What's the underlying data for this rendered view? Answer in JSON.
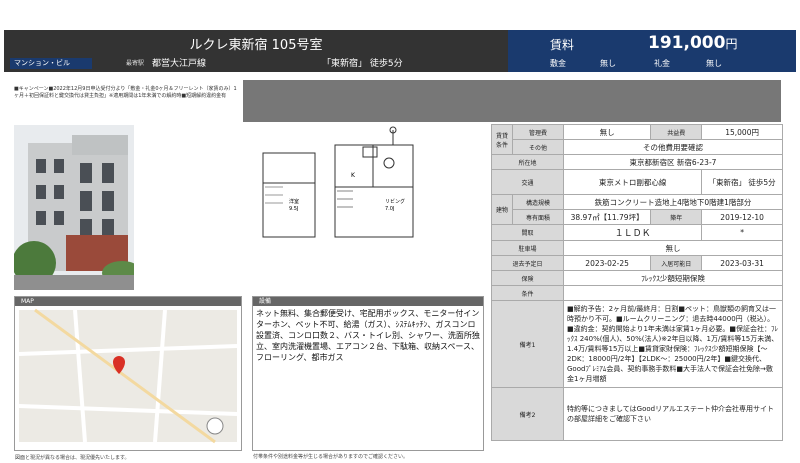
{
  "header": {
    "title": "ルクレ東新宿 105号室",
    "property_type": "マンション・ビル",
    "station_label": "最寄駅",
    "line": "都営大江戸線",
    "station_walk": "「東新宿」 徒歩5分",
    "rent_label": "賃料",
    "rent_value": "191,000",
    "rent_unit": "円",
    "deposit_label": "敷金",
    "deposit_value": "無し",
    "key_money_label": "礼金",
    "key_money_value": "無し"
  },
  "notice": "■キャンペーン■2022年12月9日申込受付分より「敷金・礼金0ヶ月＆フリーレント（家賃のみ）1ヶ月＋初回保証料と鍵交換代は貸主負担」※適用期間は1年未満での解約時■短期解約違約金有",
  "map": {
    "label": "MAP",
    "footnote": "図面と現況が異なる場合は、現況優先いたします。"
  },
  "memo": {
    "label": "設備",
    "text": "ネット無料、集合郵便受け、宅配用ボックス、モニター付インターホン、ペット不可、給湯（ガス）、ｼｽﾃﾑｷｯﾁﾝ、ガスコンロ設置済、コンロ口数２、バス・トイレ別、シャワー、洗面所独立、室内洗濯機置場、エアコン２台、下駄箱、収納スペース、フローリング、都市ガス",
    "footnote": "付帯条件や別途料金等が生じる場合がありますのでご確認ください。"
  },
  "floor_plan": {
    "room1": "洋室",
    "room1_size": "9.5J",
    "room2": "リビング",
    "room2_size": "7.0J",
    "k": "K"
  },
  "table": {
    "pay_group": "賃貸条件",
    "mgmt_label": "管理費",
    "mgmt_value": "無し",
    "common_label": "共益費",
    "common_value": "15,000円",
    "other_label": "その他",
    "other_value": "その他費用要確認",
    "address_label": "所在地",
    "address_value": "東京都新宿区 新宿6-23-7",
    "transit_label": "交通",
    "transit_line": "東京メトロ副都心線",
    "transit_walk": "「東新宿」 徒歩5分",
    "building_group": "建物",
    "structure_label": "構造規模",
    "structure_value": "鉄筋コンクリート造地上4階地下0階建1階部分",
    "area_label": "専有面積",
    "area_value": "38.97㎡【11.79坪】",
    "built_label": "築年",
    "built_value": "2019-12-10",
    "layout_label": "間取",
    "layout_value": "１ＬＤＫ",
    "layout_extra": "*",
    "parking_label": "駐車場",
    "parking_value": "無し",
    "vacate_label": "退去予定日",
    "vacate_value": "2023-02-25",
    "movein_label": "入居可能日",
    "movein_value": "2023-03-31",
    "insurance_label": "保険",
    "insurance_value": "ﾌﾚｯｸｽ少額短期保険",
    "conditions_label": "条件",
    "conditions_value": "",
    "note1_label": "備考1",
    "note1_value": "■解約予告：2ヶ月前/最終月：日割■ペット：鳥獣類の飼育又は一時預かり不可。■ルームクリーニング：退去時44000円（税込）。■違約金：契約開始より1年未満は家賃1ヶ月必要。■保証会社：ﾌﾚｯｸｽ 240%(個人)、50%(法人)※2年目以降、1万/賃料等15万未満、1.4万/賃料等15万以上■賃貸家財保険：ﾌﾚｯｸｽ少額短期保険【～2DK：18000円/2年】【2LDK～：25000円/2年】■鍵交換代、Goodﾌﾟﾚﾐｱﾑ会員、契約事務手数料■大手法人で保証会社免除→敷金1ヶ月増額",
    "note2_label": "備考2",
    "note2_value": "特約等につきましてはGoodリアルエステート仲介会社専用サイトの部屋詳細をご確認下さい"
  },
  "colors": {
    "header_dark": "#333333",
    "header_blue": "#1a3a6e",
    "label_gray": "#d9d9d9"
  }
}
